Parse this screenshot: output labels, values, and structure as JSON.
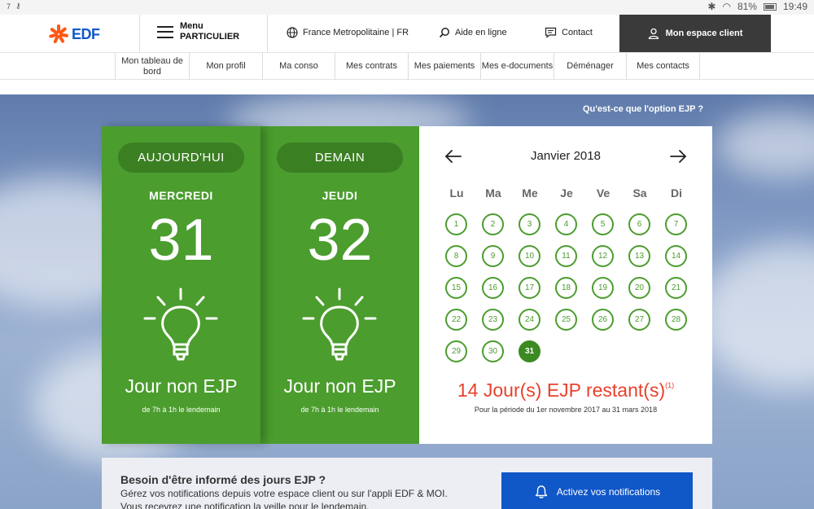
{
  "status_bar": {
    "left_small": "7",
    "battery": "81%",
    "time": "19:49"
  },
  "header": {
    "logo_text": "EDF",
    "menu_title": "Menu",
    "menu_subtitle": "PARTICULIER",
    "region": "France Metropolitaine | FR",
    "help": "Aide en ligne",
    "contact": "Contact",
    "account": "Mon espace client"
  },
  "subnav": [
    "Mon tableau de bord",
    "Mon profil",
    "Ma conso",
    "Mes contrats",
    "Mes paiements",
    "Mes e-documents",
    "Déménager",
    "Mes contacts"
  ],
  "ejp_info_link": "Qu'est-ce que l'option EJP ?",
  "today": {
    "pill": "AUJOURD'HUI",
    "weekday": "MERCREDI",
    "number": "31",
    "status": "Jour non EJP",
    "hours": "de 7h à 1h le lendemain"
  },
  "tomorrow": {
    "pill": "DEMAIN",
    "weekday": "JEUDI",
    "number": "32",
    "status": "Jour non EJP",
    "hours": "de 7h à 1h le lendemain"
  },
  "calendar": {
    "month": "Janvier 2018",
    "weekdays": [
      "Lu",
      "Ma",
      "Me",
      "Je",
      "Ve",
      "Sa",
      "Di"
    ],
    "days_in_month": 31,
    "first_weekday_index": 0,
    "selected_day": 31,
    "remaining_text": "14 Jour(s) EJP restant(s)",
    "remaining_note": "(1)",
    "period": "Pour la période du 1er novembre 2017 au 31 mars 2018"
  },
  "notification": {
    "title": "Besoin d'être informé des jours EJP ?",
    "line1": "Gérez vos notifications depuis votre espace client ou sur l'appli EDF & MOI.",
    "line2": "Vous recevrez une notification la veille pour le lendemain.",
    "button": "Activez vos notifications"
  },
  "colors": {
    "green": "#4b9d2e",
    "dark_green": "#3b7f23",
    "red": "#e8412c",
    "blue": "#1057c8",
    "orange": "#fe5815"
  }
}
